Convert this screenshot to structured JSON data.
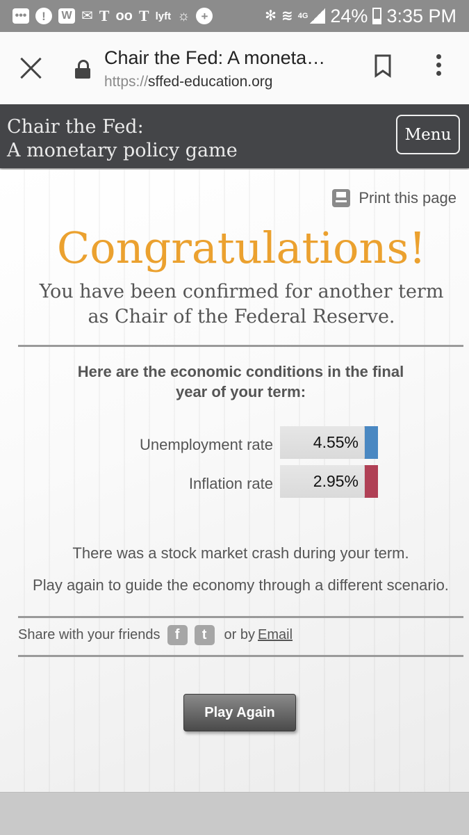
{
  "status_bar": {
    "battery": "24%",
    "time": "3:35 PM",
    "network": "4G",
    "left_icons": [
      "more-icon",
      "alert-icon",
      "w-app-icon",
      "mail-icon",
      "nyt-icon",
      "voicemail-icon",
      "nyt-icon",
      "lyft-icon",
      "location-icon",
      "plus-icon"
    ],
    "glyphs": {
      "alert": "!",
      "w": "W",
      "nyt": "T",
      "lyft": "lyft",
      "plus": "+",
      "mail": "✉",
      "voicemail": "oo",
      "sync": "☼",
      "bt": "✻",
      "wifi": "≋"
    }
  },
  "browser": {
    "page_title": "Chair the Fed: A moneta…",
    "url_scheme": "https://",
    "url_host": "sffed-education.org"
  },
  "site_header": {
    "title_line1": "Chair the Fed:",
    "title_line2": "A monetary policy game",
    "menu_label": "Menu"
  },
  "main": {
    "print_label": "Print this page",
    "heading": "Congratulations!",
    "subheading_line1": "You have been confirmed for another term",
    "subheading_line2": "as Chair of the Federal Reserve.",
    "conditions_line1": "Here are the economic conditions in the final",
    "conditions_line2": "year of your term:",
    "metrics": [
      {
        "label": "Unemployment rate",
        "value": "4.55%",
        "color": "#4a88c2"
      },
      {
        "label": "Inflation rate",
        "value": "2.95%",
        "color": "#b04055"
      }
    ],
    "event_message": "There was a stock market crash during your term.",
    "play_again_message": "Play again to guide the economy through a different scenario.",
    "share_label": "Share with your friends",
    "share_glyphs": {
      "facebook": "f",
      "twitter": "t"
    },
    "or_by_label": "or by",
    "email_label": "Email",
    "play_again_button": "Play Again",
    "accent_color": "#eba12f"
  }
}
